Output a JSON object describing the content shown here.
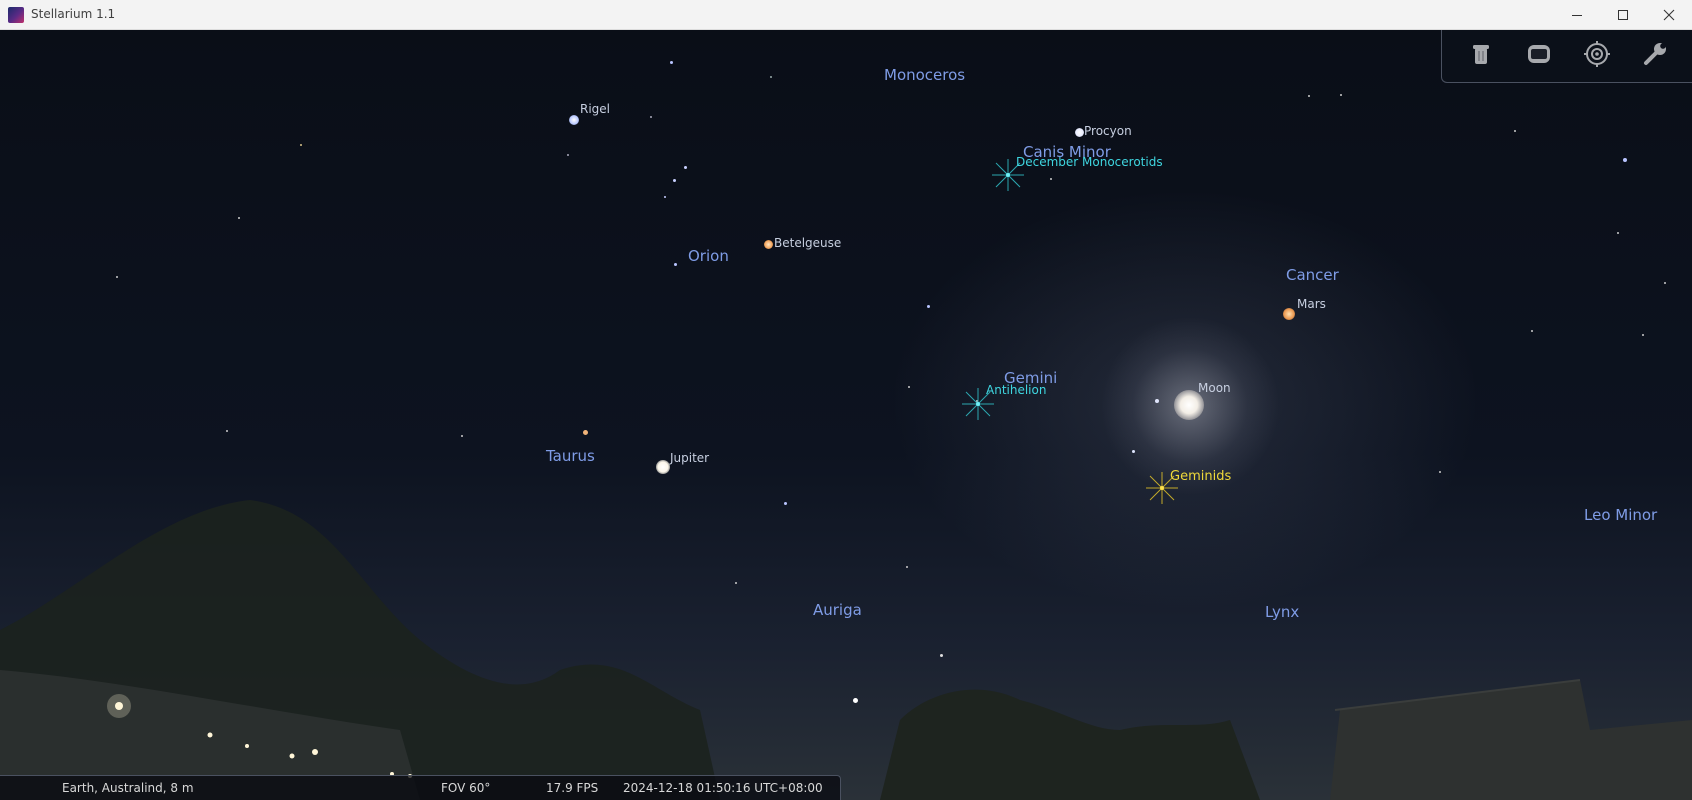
{
  "window": {
    "title": "Stellarium 1.1",
    "controls": {
      "minimize_icon": "minimize-icon",
      "maximize_icon": "maximize-icon",
      "close_icon": "close-icon"
    }
  },
  "toolbar": {
    "buttons": [
      {
        "name": "trash-can-icon"
      },
      {
        "name": "screen-icon"
      },
      {
        "name": "target-icon"
      },
      {
        "name": "wrench-icon"
      }
    ]
  },
  "sky": {
    "constellations": {
      "monoceros": "Monoceros",
      "canis_minor": "Canis Minor",
      "orion": "Orion",
      "cancer": "Cancer",
      "gemini": "Gemini",
      "taurus": "Taurus",
      "auriga": "Auriga",
      "lynx": "Lynx",
      "leo_minor": "Leo Minor"
    },
    "objects": {
      "rigel": "Rigel",
      "procyon": "Procyon",
      "betelgeuse": "Betelgeuse",
      "mars": "Mars",
      "moon": "Moon",
      "jupiter": "Jupiter"
    },
    "meteor_showers": {
      "december_monocerotids": "December Monocerotids",
      "antihelion": "Antihelion",
      "geminids": "Geminids"
    }
  },
  "status": {
    "location": "Earth, Australind, 8 m",
    "fov": "FOV 60°",
    "fps": "17.9 FPS",
    "datetime": "2024-12-18 01:50:16 UTC+08:00"
  },
  "colors": {
    "constellation_label": "#7f9ce6",
    "meteor_label": "#3fd6e0",
    "geminids_label": "#f0d93a",
    "sky": "#0d1320"
  }
}
